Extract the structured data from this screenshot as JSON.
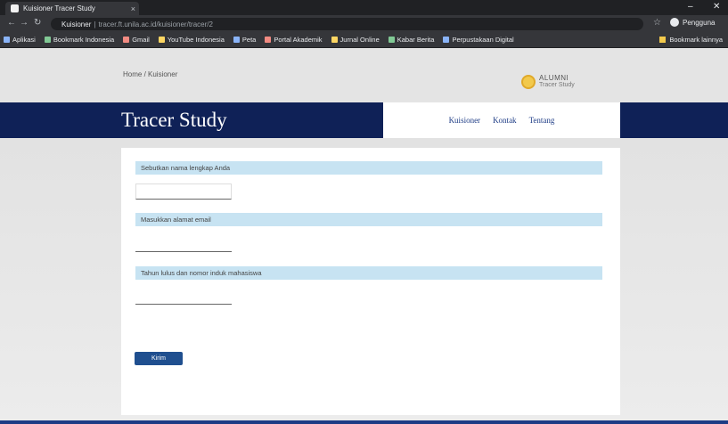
{
  "browser": {
    "tab_title": "Kuisioner Tracer Study",
    "tab_close": "×",
    "window_minimize": "–",
    "window_close": "✕",
    "site_name": "Kuisioner",
    "url": "tracer.ft.unila.ac.id/kuisioner/tracer/2",
    "profile_name": "Pengguna",
    "bookmarks": [
      "Aplikasi",
      "Bookmark Indonesia",
      "Gmail",
      "YouTube Indonesia",
      "Peta",
      "Portal Akademik",
      "Jurnal Online",
      "Kabar Berita",
      "Perpustakaan Digital"
    ],
    "other_bookmarks": "Bookmark lainnya"
  },
  "page": {
    "breadcrumb": "Home / Kuisioner",
    "logo_line1": "ALUMNI",
    "logo_line2": "Tracer Study",
    "brand": "Tracer Study",
    "nav": [
      "Kuisioner",
      "Kontak",
      "Tentang"
    ],
    "questions": [
      {
        "label": "Sebutkan nama lengkap Anda",
        "value": ""
      },
      {
        "label": "Masukkan alamat email",
        "value": ""
      },
      {
        "label": "Tahun lulus dan nomor induk mahasiswa",
        "value": ""
      }
    ],
    "submit_label": "Kirim"
  },
  "colors": {
    "header_navy": "#0f2157",
    "question_bar": "#c7e3f2",
    "button_blue": "#1f4f8f"
  }
}
